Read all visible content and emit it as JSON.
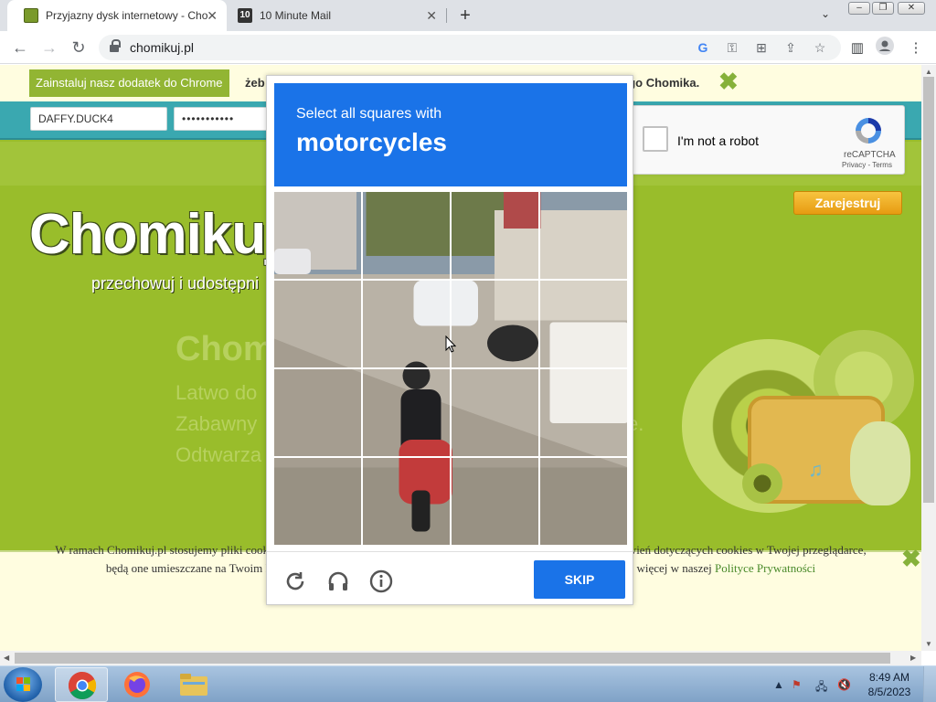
{
  "browser": {
    "tabs": [
      {
        "title": "Przyjazny dysk internetowy - Cho"
      },
      {
        "title": "10 Minute Mail",
        "favicon_text": "10"
      }
    ],
    "address": "chomikuj.pl"
  },
  "page": {
    "promo": {
      "install_button": "Zainstaluj nasz dodatek do Chrome",
      "text_left": "żeb",
      "text_right": "ego Chomika."
    },
    "login": {
      "username": "DAFFY.DUCK4",
      "password": "•••••••••••"
    },
    "register_button": "Zarejestruj",
    "logo": "Chomikuj.",
    "tagline": "przechowuj i udostępni",
    "ghost": {
      "title": "Chom",
      "line1": "Latwo do",
      "line2": "Zabawny",
      "line3": "Odtwarza",
      "right": "e."
    },
    "cookie": {
      "line1": "W ramach Chomikuj.pl stosujemy pliki cookies by umożliwić Ci wygodne korzystanie z serwisu. Jeśli nie zmienisz ustawień dotyczących cookies w Twojej przeglądarce,",
      "line2": "będą one umieszczane na Twoim komputerze. W każdej chwili możesz zmienić swoje ustawienia. Dowiedz się więcej w naszej ",
      "link": "Polityce Prywatności"
    }
  },
  "recaptcha": {
    "checkbox_label": "I'm not a robot",
    "brand": "reCAPTCHA",
    "links": "Privacy - Terms",
    "checked": false
  },
  "challenge": {
    "instruction": "Select all squares with",
    "target": "motorcycles",
    "grid_size": 4,
    "skip": "SKIP",
    "footer_icons": [
      "reload-icon",
      "audio-icon",
      "info-icon"
    ]
  },
  "taskbar": {
    "time": "8:49 AM",
    "date": "8/5/2023",
    "apps": [
      "chrome-icon",
      "firefox-icon",
      "file-explorer-icon"
    ]
  }
}
